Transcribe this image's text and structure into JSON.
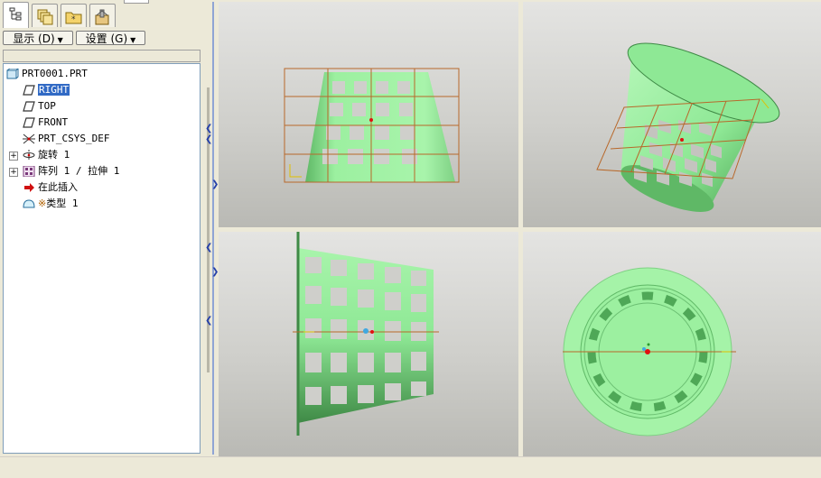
{
  "toolbar": {
    "tabs": [
      "model-tree-tab",
      "layers-tab",
      "favorites-tab",
      "tools-tab"
    ],
    "show_button": "显示 (D)",
    "settings_button": "设置 (G)"
  },
  "model_tree": {
    "items": [
      {
        "label": "PRT0001.PRT",
        "icon": "part-icon"
      },
      {
        "label": "RIGHT",
        "icon": "datum-plane-icon",
        "selected": true
      },
      {
        "label": "TOP",
        "icon": "datum-plane-icon"
      },
      {
        "label": "FRONT",
        "icon": "datum-plane-icon"
      },
      {
        "label": "PRT_CSYS_DEF",
        "icon": "coordinate-system-icon"
      },
      {
        "label": "旋转 1",
        "icon": "revolve-icon",
        "expandable": true
      },
      {
        "label": "阵列 1 / 拉伸 1",
        "icon": "pattern-icon",
        "expandable": true
      },
      {
        "label": "在此插入",
        "icon": "insert-here-arrow-icon"
      },
      {
        "label": "类型 1",
        "icon": "cosmetic-feature-icon"
      }
    ]
  },
  "colors": {
    "model_green": "#9cf0a0",
    "model_dark": "#3f8a46",
    "datum_plane": "#b8682a",
    "selection": "#316ac5"
  }
}
